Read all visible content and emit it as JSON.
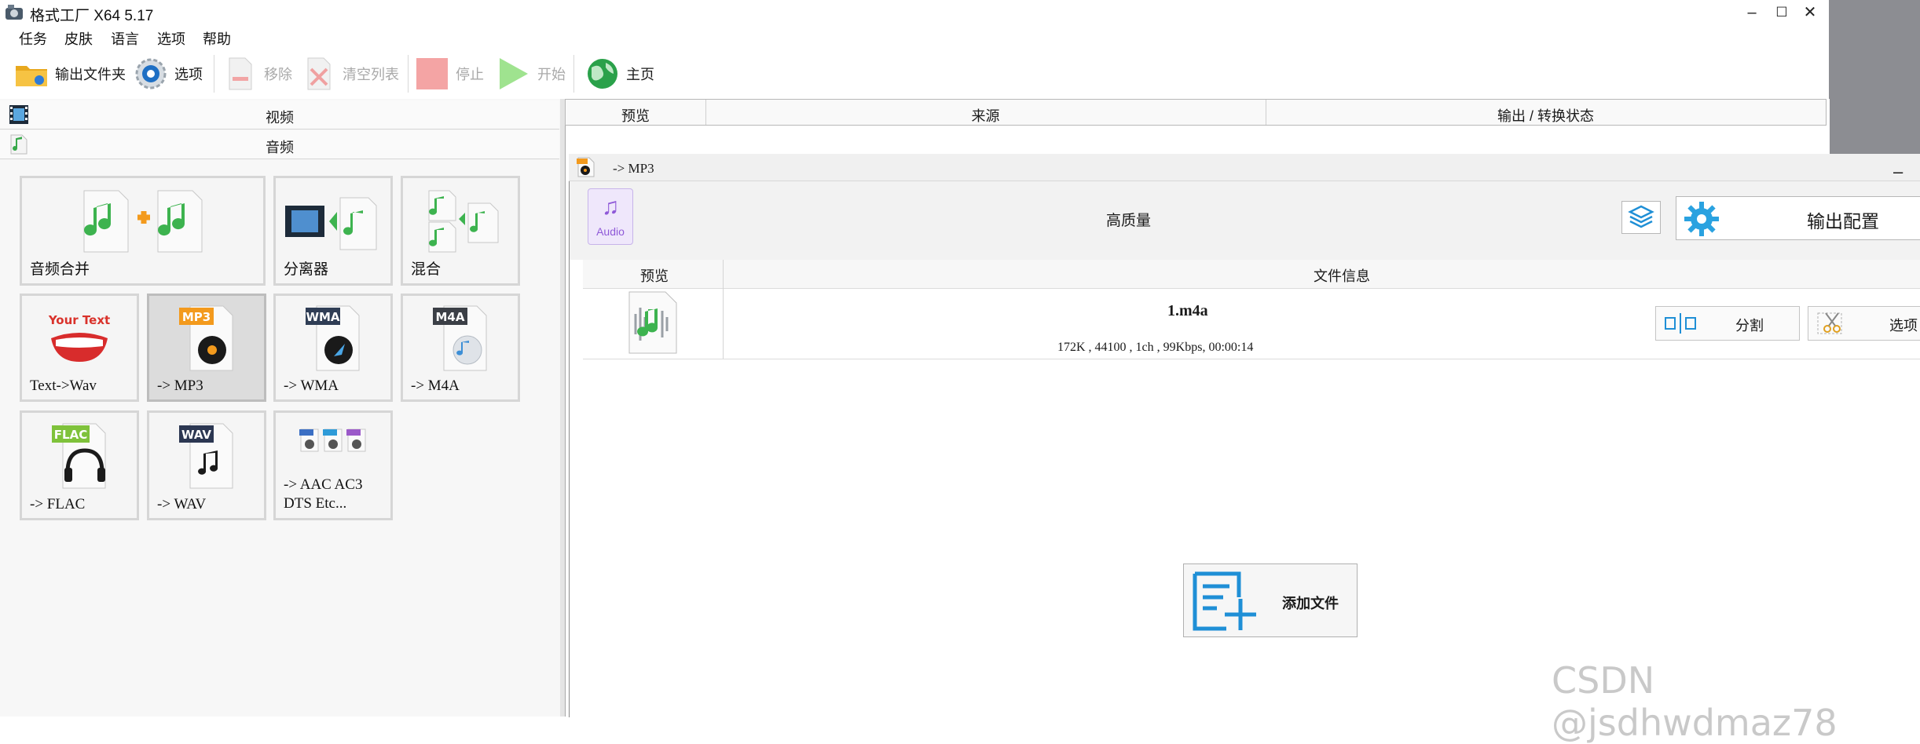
{
  "window": {
    "title": "格式工厂 X64 5.17",
    "controls": [
      "–",
      "☐",
      "✕"
    ]
  },
  "menu": [
    "任务",
    "皮肤",
    "语言",
    "选项",
    "帮助"
  ],
  "toolbar": {
    "output_folder": "输出文件夹",
    "options": "选项",
    "remove": "移除",
    "clear_list": "清空列表",
    "stop": "停止",
    "start": "开始",
    "home": "主页"
  },
  "categories": {
    "video": "视频",
    "audio": "音频"
  },
  "tiles": [
    {
      "label": "音频合并",
      "icon": "audio-merge-icon"
    },
    {
      "label": "分离器",
      "icon": "splitter-icon"
    },
    {
      "label": "混合",
      "icon": "mix-icon"
    },
    {
      "label": "Text->Wav",
      "icon": "text-to-wav-icon",
      "art_text": "Your Text"
    },
    {
      "label": "-> MP3",
      "icon": "mp3-icon",
      "badge": "MP3",
      "selected": true
    },
    {
      "label": "-> WMA",
      "icon": "wma-icon",
      "badge": "WMA"
    },
    {
      "label": "-> M4A",
      "icon": "m4a-icon",
      "badge": "M4A"
    },
    {
      "label": "-> FLAC",
      "icon": "flac-icon",
      "badge": "FLAC"
    },
    {
      "label": "-> WAV",
      "icon": "wav-icon",
      "badge": "WAV"
    },
    {
      "label": "-> AAC AC3\nDTS Etc...",
      "icon": "aac-ac3-dts-icon"
    }
  ],
  "list_header": {
    "preview": "预览",
    "source": "来源",
    "output_status": "输出 / 转换状态"
  },
  "dialog": {
    "title": "-> MP3",
    "audio_badge": "Audio",
    "quality": "高质量",
    "output_config": "输出配置",
    "file_header": {
      "preview": "预览",
      "file_info": "文件信息"
    },
    "file": {
      "name": "1.m4a",
      "meta": "172K , 44100 , 1ch , 99Kbps, 00:00:14"
    },
    "split_label": "分割",
    "options_label": "选项",
    "add_file": "添加文件",
    "minimize": "–"
  },
  "watermark": "CSDN @jsdhwdmaz78",
  "colors": {
    "accent_blue": "#1f8fd6",
    "green": "#3ab54a",
    "orange": "#f39a1d",
    "selected_tile": "#dcdcdc"
  }
}
